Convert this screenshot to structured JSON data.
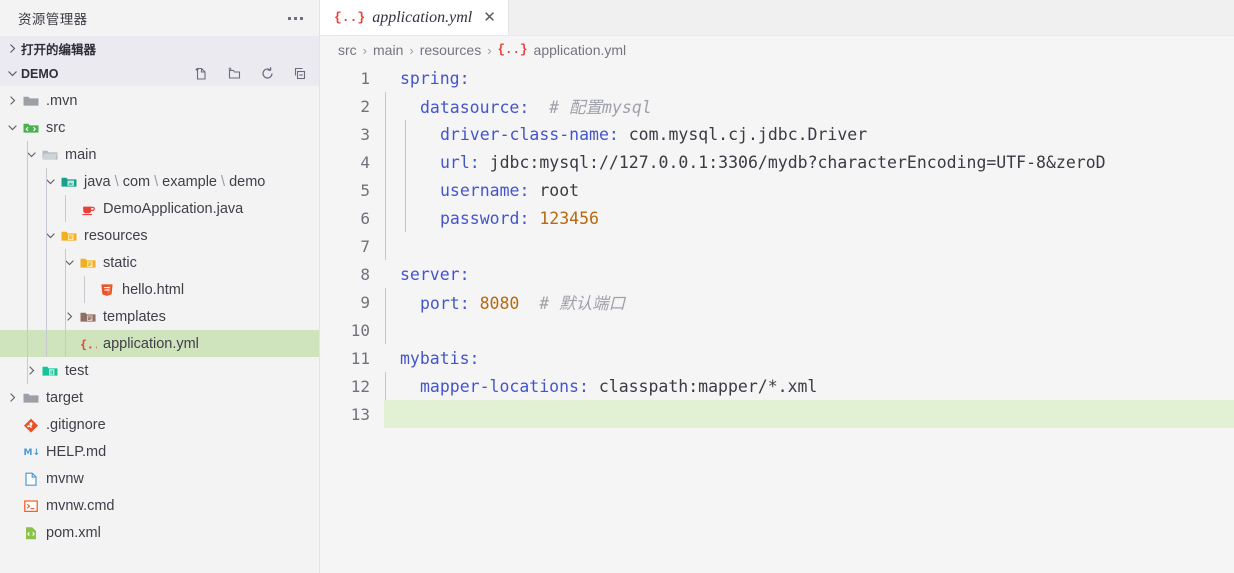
{
  "sidebar": {
    "title": "资源管理器",
    "more_label": "...",
    "sections": [
      {
        "label": "打开的编辑器",
        "expanded": false
      },
      {
        "label": "DEMO",
        "expanded": true
      }
    ],
    "actions": [
      {
        "name": "new-file",
        "tooltip": "新建文件"
      },
      {
        "name": "new-folder",
        "tooltip": "新建文件夹"
      },
      {
        "name": "refresh",
        "tooltip": "刷新资源管理器"
      },
      {
        "name": "collapse-all",
        "tooltip": "在资源管理器中折叠文件夹"
      }
    ],
    "tree": [
      {
        "label": ".mvn",
        "indent": 1,
        "arrow": "right",
        "icon": "folder-gray",
        "selected": false
      },
      {
        "label": "src",
        "indent": 1,
        "arrow": "down",
        "icon": "folder-src-green",
        "selected": false
      },
      {
        "label": "main",
        "indent": 2,
        "arrow": "down",
        "icon": "folder-open-gray",
        "selected": false
      },
      {
        "label": "java \\ com \\ example \\ demo",
        "indent": 3,
        "arrow": "down",
        "icon": "folder-java-teal",
        "selected": false
      },
      {
        "label": "DemoApplication.java",
        "indent": 4,
        "arrow": "none",
        "icon": "java-cup",
        "selected": false
      },
      {
        "label": "resources",
        "indent": 3,
        "arrow": "down",
        "icon": "folder-resources-yellow",
        "selected": false
      },
      {
        "label": "static",
        "indent": 4,
        "arrow": "down",
        "icon": "folder-static-yellow",
        "selected": false
      },
      {
        "label": "hello.html",
        "indent": 5,
        "arrow": "none",
        "icon": "html5",
        "selected": false
      },
      {
        "label": "templates",
        "indent": 4,
        "arrow": "right",
        "icon": "folder-templates-brown",
        "selected": false
      },
      {
        "label": "application.yml",
        "indent": 4,
        "arrow": "none",
        "icon": "yaml-braces",
        "selected": true
      },
      {
        "label": "test",
        "indent": 2,
        "arrow": "right",
        "icon": "folder-test-teal",
        "selected": false
      },
      {
        "label": "target",
        "indent": 1,
        "arrow": "right",
        "icon": "folder-gray",
        "selected": false
      },
      {
        "label": ".gitignore",
        "indent": 1,
        "arrow": "none",
        "icon": "git",
        "selected": false
      },
      {
        "label": "HELP.md",
        "indent": 1,
        "arrow": "none",
        "icon": "markdown",
        "selected": false
      },
      {
        "label": "mvnw",
        "indent": 1,
        "arrow": "none",
        "icon": "file-blank",
        "selected": false
      },
      {
        "label": "mvnw.cmd",
        "indent": 1,
        "arrow": "none",
        "icon": "console",
        "selected": false
      },
      {
        "label": "pom.xml",
        "indent": 1,
        "arrow": "none",
        "icon": "xml-green",
        "selected": false
      }
    ]
  },
  "editor": {
    "tab": {
      "icon_label": "{..}",
      "filename": "application.yml",
      "close_label": "✕",
      "preview_italic": true
    },
    "breadcrumb": {
      "icon_label": "{..}",
      "parts": [
        "src",
        "main",
        "resources",
        "application.yml"
      ],
      "separator": "›"
    },
    "lines": [
      {
        "no": "1",
        "indent": 0,
        "guides": 0,
        "tokens": [
          {
            "t": "k",
            "s": "spring:"
          }
        ]
      },
      {
        "no": "2",
        "indent": 1,
        "guides": 1,
        "tokens": [
          {
            "t": "k",
            "s": "datasource:"
          },
          {
            "t": "cm",
            "s": "  # 配置mysql"
          }
        ]
      },
      {
        "no": "3",
        "indent": 2,
        "guides": 2,
        "tokens": [
          {
            "t": "k",
            "s": "driver-class-name:"
          },
          {
            "t": "v",
            "s": " com.mysql.cj.jdbc.Driver"
          }
        ]
      },
      {
        "no": "4",
        "indent": 2,
        "guides": 2,
        "tokens": [
          {
            "t": "k",
            "s": "url:"
          },
          {
            "t": "v",
            "s": " jdbc:mysql://127.0.0.1:3306/mydb?characterEncoding=UTF-8&zeroD"
          }
        ]
      },
      {
        "no": "5",
        "indent": 2,
        "guides": 2,
        "tokens": [
          {
            "t": "k",
            "s": "username:"
          },
          {
            "t": "v",
            "s": " root"
          }
        ]
      },
      {
        "no": "6",
        "indent": 2,
        "guides": 2,
        "tokens": [
          {
            "t": "k",
            "s": "password:"
          },
          {
            "t": "num",
            "s": " 123456"
          }
        ]
      },
      {
        "no": "7",
        "indent": 0,
        "guides": 1,
        "tokens": []
      },
      {
        "no": "8",
        "indent": 0,
        "guides": 0,
        "tokens": [
          {
            "t": "k",
            "s": "server:"
          }
        ]
      },
      {
        "no": "9",
        "indent": 1,
        "guides": 1,
        "tokens": [
          {
            "t": "k",
            "s": "port:"
          },
          {
            "t": "num",
            "s": " 8080"
          },
          {
            "t": "cm",
            "s": "  # 默认端口"
          }
        ]
      },
      {
        "no": "10",
        "indent": 0,
        "guides": 1,
        "tokens": []
      },
      {
        "no": "11",
        "indent": 0,
        "guides": 0,
        "tokens": [
          {
            "t": "k",
            "s": "mybatis:"
          }
        ]
      },
      {
        "no": "12",
        "indent": 1,
        "guides": 1,
        "tokens": [
          {
            "t": "k",
            "s": "mapper-locations:"
          },
          {
            "t": "v",
            "s": " classpath:mapper/*.xml"
          }
        ]
      },
      {
        "no": "13",
        "indent": 0,
        "guides": 0,
        "tokens": [],
        "highlight": true
      }
    ]
  },
  "colors": {
    "sidebar_bg": "#f3f3f3",
    "section_bg": "#eceaf1",
    "selected_row": "#cfe4bd",
    "current_line": "#e2f0d3",
    "key": "#4455cc",
    "value": "#3b3b44",
    "number": "#b8690f",
    "comment": "#a0a0ab",
    "tab_active_bg": "#ffffff",
    "editor_bg": "#f5f5f5"
  }
}
